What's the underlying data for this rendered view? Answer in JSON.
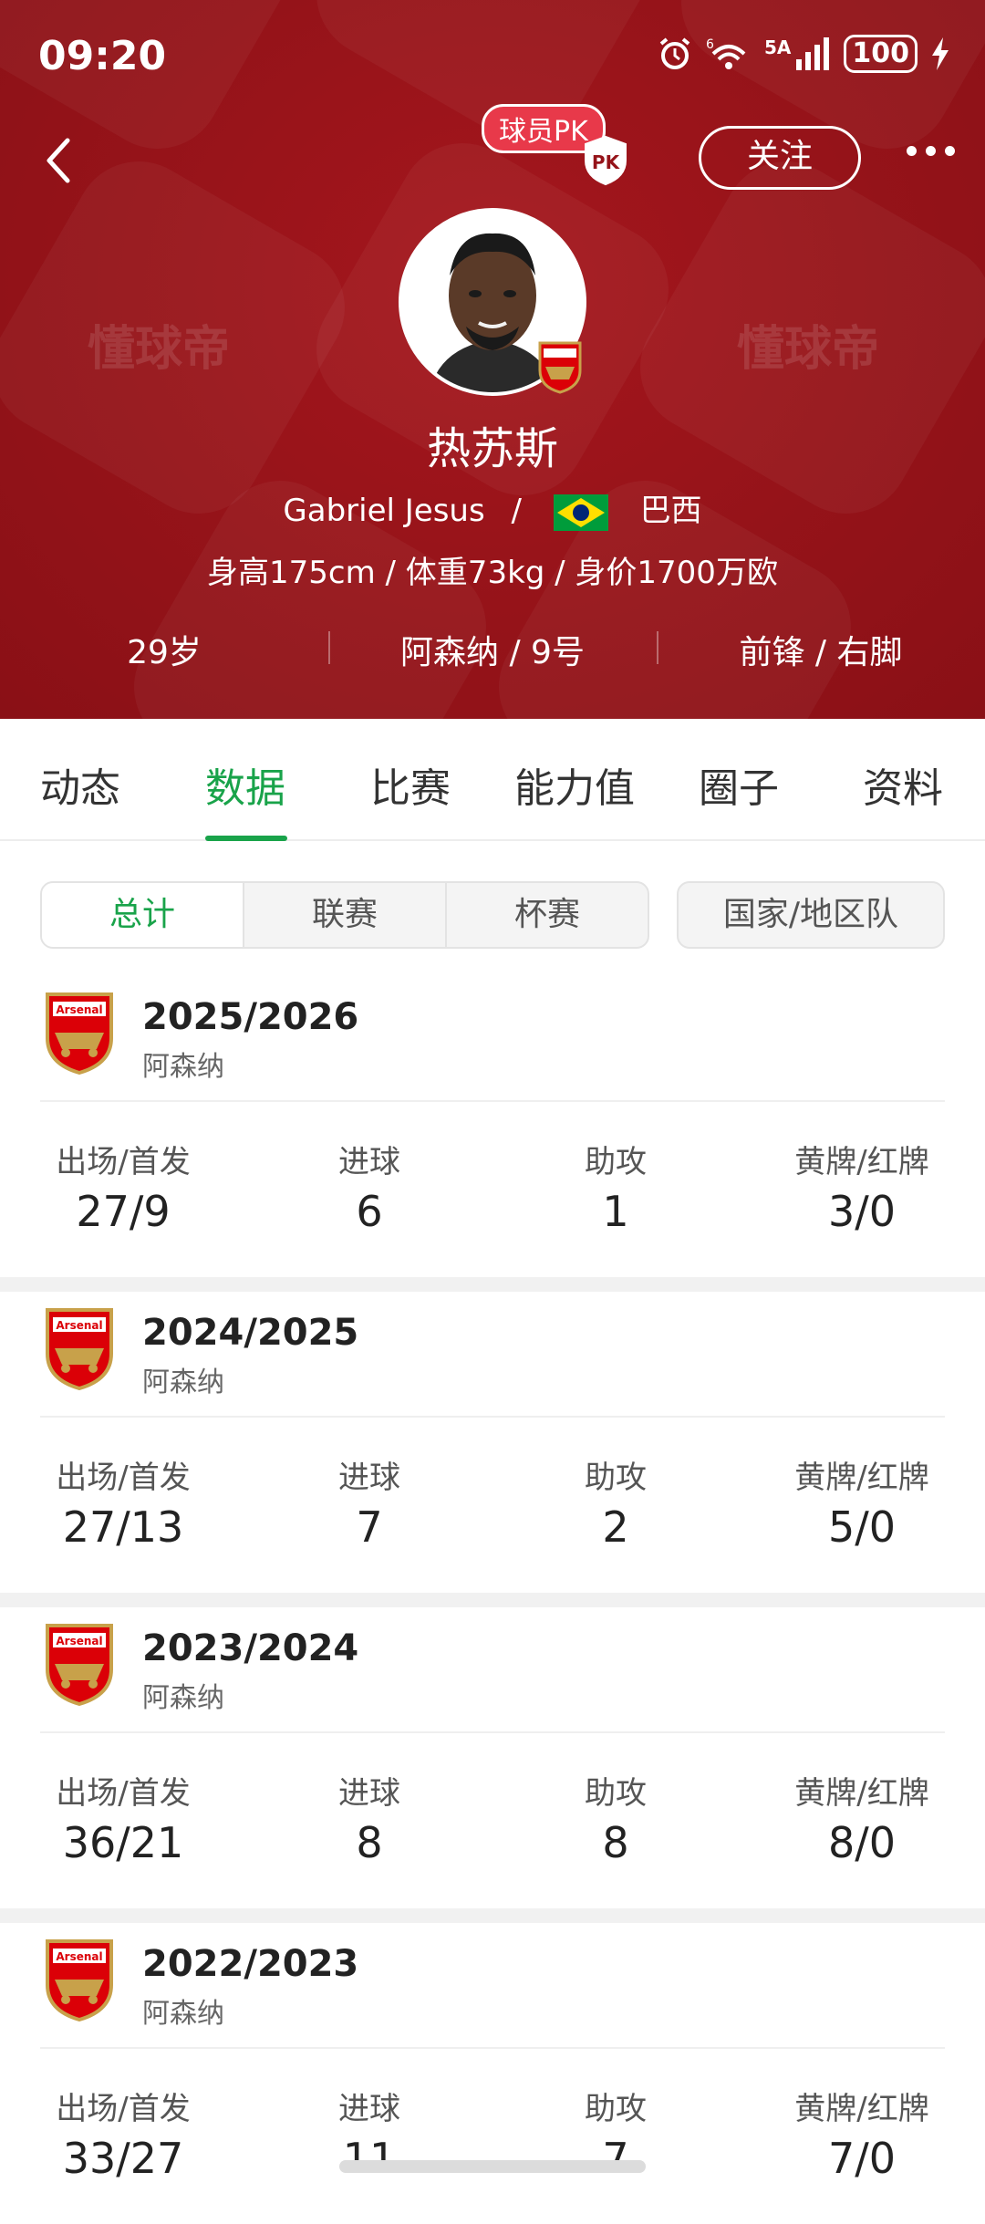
{
  "status_bar": {
    "time": "09:20",
    "network": "5A",
    "battery": "100",
    "signal_prefix": "6"
  },
  "header": {
    "pk_label": "球员PK",
    "pk_shield_text": "PK",
    "follow_label": "关注",
    "watermark": "懂球帝",
    "player_cn_name": "热苏斯",
    "player_en_name": "Gabriel Jesus",
    "separator": "/",
    "nationality": "巴西",
    "physical": "身高175cm / 体重73kg / 身价1700万欧",
    "age": "29岁",
    "club_number": "阿森纳 / 9号",
    "position_foot": "前锋 / 右脚",
    "accent_color": "#951319"
  },
  "tabs": [
    "动态",
    "数据",
    "比赛",
    "能力值",
    "圈子",
    "资料"
  ],
  "active_tab": "数据",
  "filters": [
    "总计",
    "联赛",
    "杯赛"
  ],
  "filter_national": "国家/地区队",
  "stat_labels": {
    "apps": "出场/首发",
    "goals": "进球",
    "assists": "助攻",
    "cards": "黄牌/红牌"
  },
  "seasons": [
    {
      "year": "2025/2026",
      "club": "阿森纳",
      "apps": "27/9",
      "goals": "6",
      "assists": "1",
      "cards": "3/0"
    },
    {
      "year": "2024/2025",
      "club": "阿森纳",
      "apps": "27/13",
      "goals": "7",
      "assists": "2",
      "cards": "5/0"
    },
    {
      "year": "2023/2024",
      "club": "阿森纳",
      "apps": "36/21",
      "goals": "8",
      "assists": "8",
      "cards": "8/0"
    },
    {
      "year": "2022/2023",
      "club": "阿森纳",
      "apps": "33/27",
      "goals": "11",
      "assists": "7",
      "cards": "7/0"
    }
  ],
  "crest_text": "Arsenal",
  "green_accent": "#19a34a"
}
